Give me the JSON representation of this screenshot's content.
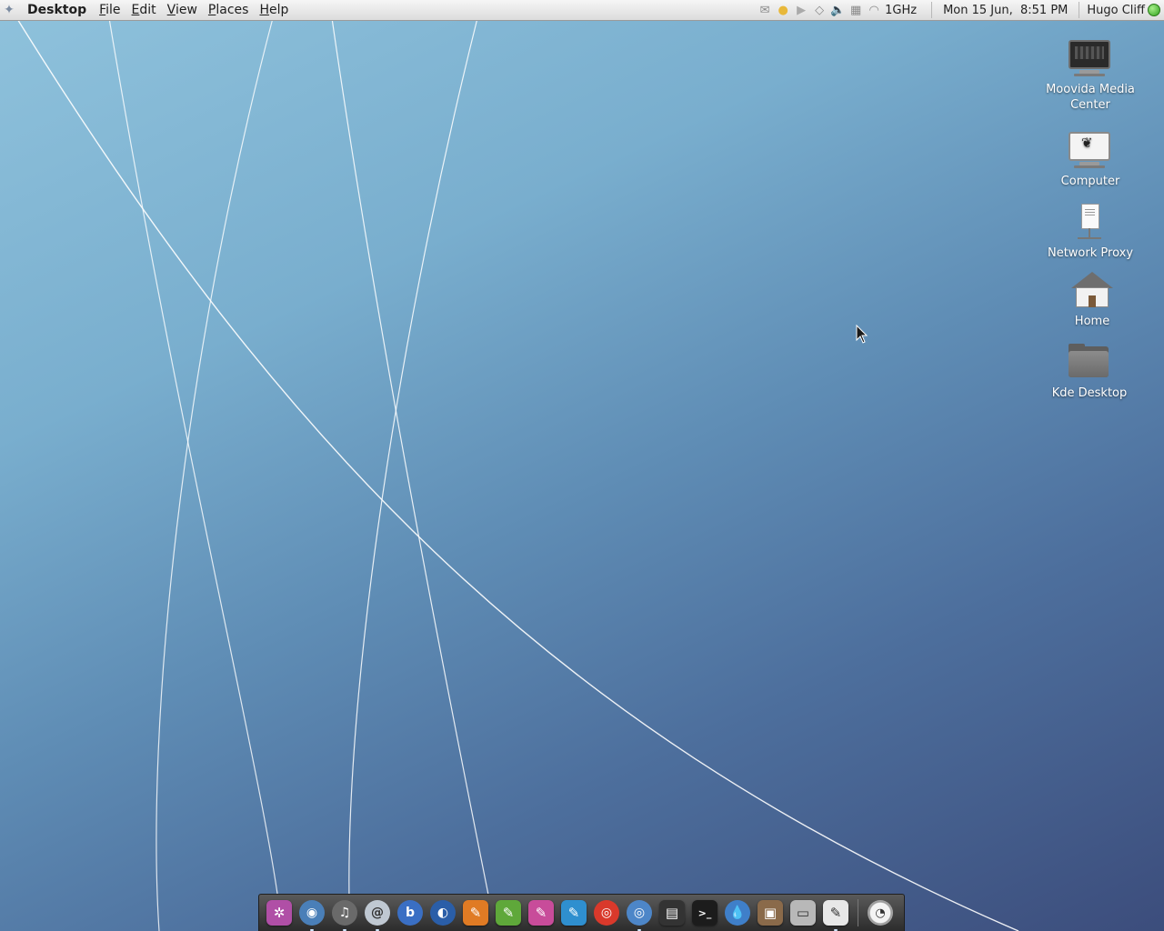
{
  "panel": {
    "app_name": "Desktop",
    "menus": [
      {
        "label": "File",
        "mnemonic": "F",
        "rest": "ile"
      },
      {
        "label": "Edit",
        "mnemonic": "E",
        "rest": "dit"
      },
      {
        "label": "View",
        "mnemonic": "V",
        "rest": "iew"
      },
      {
        "label": "Places",
        "mnemonic": "P",
        "rest": "laces"
      },
      {
        "label": "Help",
        "mnemonic": "H",
        "rest": "elp"
      }
    ],
    "tray_icons": [
      "mail-icon",
      "tomboy-icon",
      "play-icon",
      "network-icon",
      "volume-icon",
      "display-icon",
      "cpu-freq-icon"
    ],
    "cpu_frequency": "1GHz",
    "clock": "Mon 15 Jun,  8:51 PM",
    "user_name": "Hugo Cliff",
    "status_color": "#3cb42a"
  },
  "desktop_icons": [
    {
      "label_line1": "Moovida Media",
      "label_line2": "Center",
      "icon": "media-center-icon"
    },
    {
      "label_line1": "Computer",
      "label_line2": "",
      "icon": "computer-icon"
    },
    {
      "label_line1": "Network Proxy",
      "label_line2": "",
      "icon": "network-proxy-icon"
    },
    {
      "label_line1": "Home",
      "label_line2": "",
      "icon": "home-icon"
    },
    {
      "label_line1": "Kde Desktop",
      "label_line2": "",
      "icon": "folder-icon"
    }
  ],
  "dock": {
    "items": [
      {
        "icon": "settings-icon",
        "glyph": "✲",
        "color": "#b04fa6",
        "shape": "tile",
        "running": false
      },
      {
        "icon": "firefox-icon",
        "glyph": "◉",
        "color": "#4a7fb8",
        "shape": "round",
        "running": true
      },
      {
        "icon": "music-player-icon",
        "glyph": "♫",
        "color": "#6a6a6a",
        "shape": "round",
        "running": true
      },
      {
        "icon": "chat-icon",
        "glyph": "@",
        "color": "#bfc8d2",
        "shape": "round",
        "running": true
      },
      {
        "icon": "b-app-icon",
        "glyph": "b",
        "color": "#3a6fc4",
        "shape": "round",
        "running": false
      },
      {
        "icon": "google-earth-icon",
        "glyph": "◐",
        "color": "#2a5ea8",
        "shape": "round",
        "running": false
      },
      {
        "icon": "office-orange-icon",
        "glyph": "✎",
        "color": "#e07b24",
        "shape": "tile",
        "running": false
      },
      {
        "icon": "office-green-icon",
        "glyph": "✎",
        "color": "#5fa83a",
        "shape": "tile",
        "running": false
      },
      {
        "icon": "office-pink-icon",
        "glyph": "✎",
        "color": "#c84c9a",
        "shape": "tile",
        "running": false
      },
      {
        "icon": "office-blue-icon",
        "glyph": "✎",
        "color": "#2f8fcf",
        "shape": "tile",
        "running": false
      },
      {
        "icon": "chrome-icon",
        "glyph": "◎",
        "color": "#d9392b",
        "shape": "round",
        "running": false
      },
      {
        "icon": "chromium-icon",
        "glyph": "◎",
        "color": "#4d86c8",
        "shape": "round",
        "running": true
      },
      {
        "icon": "media-center-icon",
        "glyph": "▤",
        "color": "#333333",
        "shape": "tile",
        "running": false
      },
      {
        "icon": "terminal-icon",
        "glyph": ">_",
        "color": "#1c1c1c",
        "shape": "tile",
        "running": false
      },
      {
        "icon": "water-drop-icon",
        "glyph": "💧",
        "color": "#3f7fc9",
        "shape": "round",
        "running": false
      },
      {
        "icon": "photo-manager-icon",
        "glyph": "▣",
        "color": "#8a6a4a",
        "shape": "tile",
        "running": false
      },
      {
        "icon": "computer-icon",
        "glyph": "▭",
        "color": "#b8b8b8",
        "shape": "tile",
        "running": false
      },
      {
        "icon": "office-gray-icon",
        "glyph": "✎",
        "color": "#e8e8e8",
        "shape": "tile",
        "running": true
      }
    ],
    "trailing_icon": "clock-icon"
  }
}
